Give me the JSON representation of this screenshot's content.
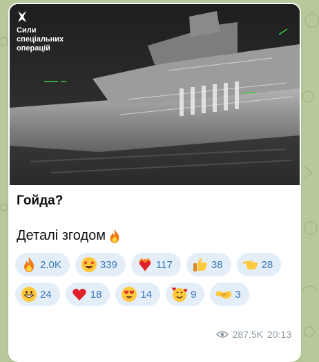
{
  "watermark": {
    "lines": [
      "Сили",
      "спеціальних",
      "операцій"
    ]
  },
  "post": {
    "title": "Гойда?",
    "text": "Деталі згодом"
  },
  "reactions": [
    {
      "emoji": "fire",
      "count": "2.0K"
    },
    {
      "emoji": "star-struck",
      "count": "339"
    },
    {
      "emoji": "heart-on-fire",
      "count": "117"
    },
    {
      "emoji": "thumbs-up",
      "count": "38"
    },
    {
      "emoji": "pointing-hand",
      "count": "28"
    },
    {
      "emoji": "grinning-face",
      "count": "24"
    },
    {
      "emoji": "red-heart",
      "count": "18"
    },
    {
      "emoji": "heart-eyes",
      "count": "14"
    },
    {
      "emoji": "smiling-face-with-hearts",
      "count": "9"
    },
    {
      "emoji": "handshake",
      "count": "3"
    }
  ],
  "meta": {
    "views": "287.5K",
    "time": "20:13"
  },
  "colors": {
    "accent": "#3a78b5",
    "chip_bg": "#e4eef9",
    "wallpaper": "#b7c89a"
  }
}
